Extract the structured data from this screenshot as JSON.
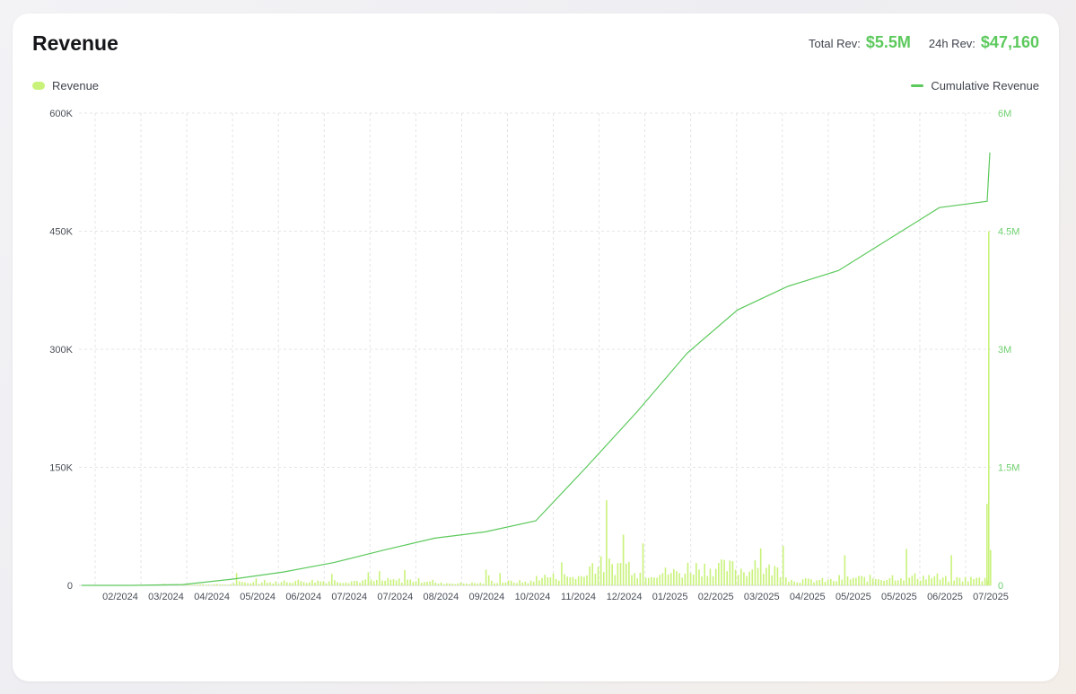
{
  "card": {
    "title": "Revenue",
    "total_rev_label": "Total Rev:",
    "total_rev_value": "$5.5M",
    "rev_24h_label": "24h Rev:",
    "rev_24h_value": "$47,160"
  },
  "legend": {
    "bar_label": "Revenue",
    "line_label": "Cumulative Revenue"
  },
  "colors": {
    "bar": "#c9f27a",
    "line": "#5cc95c",
    "grid": "#e4e4e8",
    "right_axis_text": "#6fcf6f"
  },
  "chart_data": {
    "type": "bar",
    "combo": "bar + line (dual axis)",
    "title": "Revenue",
    "xlabel": "",
    "ylabel": "",
    "ylim": [
      0,
      600000
    ],
    "y2lim": [
      0,
      6000000
    ],
    "left_ticks": [
      "0",
      "150K",
      "300K",
      "450K",
      "600K"
    ],
    "right_ticks": [
      "0",
      "1.5M",
      "3M",
      "4.5M",
      "6M"
    ],
    "x_ticks": [
      "02/2024",
      "03/2024",
      "04/2024",
      "05/2024",
      "06/2024",
      "07/2024",
      "07/2024",
      "08/2024",
      "09/2024",
      "10/2024",
      "11/2024",
      "12/2024",
      "01/2025",
      "02/2025",
      "03/2025",
      "04/2025",
      "05/2025",
      "05/2025",
      "06/2025",
      "07/2025"
    ],
    "grid": "dashed vertical and horizontal",
    "legend_position": "top-left (bars), top-right (line)",
    "series": [
      {
        "name": "Revenue",
        "kind": "bar",
        "axis": "left",
        "x": [
          "02/2024",
          "03/2024",
          "04/2024",
          "05/2024",
          "06/2024",
          "07/2024",
          "08/2024",
          "09/2024",
          "10/2024",
          "11/2024",
          "12/2024",
          "01/2025",
          "02/2025",
          "03/2025",
          "04/2025",
          "05/2025",
          "06/2025",
          "07/2025"
        ],
        "values": [
          500,
          1500,
          4000,
          6000,
          6000,
          7000,
          3000,
          5000,
          12000,
          28000,
          18000,
          25000,
          22000,
          7000,
          10000,
          12000,
          9000,
          450000
        ]
      },
      {
        "name": "Cumulative Revenue",
        "kind": "line",
        "axis": "right",
        "x": [
          "01/2024",
          "02/2024",
          "03/2024",
          "04/2024",
          "05/2024",
          "06/2024",
          "07/2024",
          "08/2024",
          "09/2024",
          "10/2024",
          "11/2024",
          "12/2024",
          "01/2025",
          "02/2025",
          "03/2025",
          "04/2025",
          "05/2025",
          "06/2025",
          "07/2025"
        ],
        "values": [
          0,
          0,
          10000,
          80000,
          170000,
          290000,
          450000,
          600000,
          680000,
          820000,
          1500000,
          2200000,
          2950000,
          3500000,
          3800000,
          4000000,
          4400000,
          4800000,
          5500000
        ]
      }
    ]
  }
}
